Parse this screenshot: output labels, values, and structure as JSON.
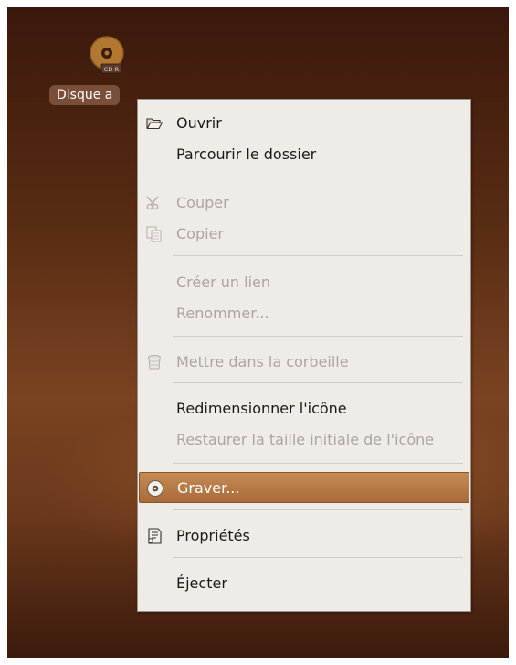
{
  "desktop": {
    "disc_label": "Disque a",
    "disc_badge": "CD-R"
  },
  "menu": {
    "items": [
      {
        "label": "Ouvrir",
        "icon": "folder-open-icon",
        "enabled": true
      },
      {
        "label": "Parcourir le dossier",
        "enabled": true
      },
      {
        "label": "Couper",
        "icon": "scissors-icon",
        "enabled": false
      },
      {
        "label": "Copier",
        "icon": "copy-icon",
        "enabled": false
      },
      {
        "label": "Créer un lien",
        "enabled": false
      },
      {
        "label": "Renommer...",
        "enabled": false
      },
      {
        "label": "Mettre dans la corbeille",
        "icon": "trash-icon",
        "enabled": false
      },
      {
        "label": "Redimensionner l'icône",
        "enabled": true
      },
      {
        "label": "Restaurer la taille initiale de l'icône",
        "enabled": false
      },
      {
        "label": "Graver...",
        "icon": "disc-burn-icon",
        "enabled": true,
        "highlighted": true
      },
      {
        "label": "Propriétés",
        "icon": "properties-icon",
        "enabled": true
      },
      {
        "label": "Éjecter",
        "enabled": true
      }
    ]
  },
  "colors": {
    "highlight": "#b47a46",
    "menu_bg": "#efebe7",
    "disabled_text": "#aaa59f"
  }
}
